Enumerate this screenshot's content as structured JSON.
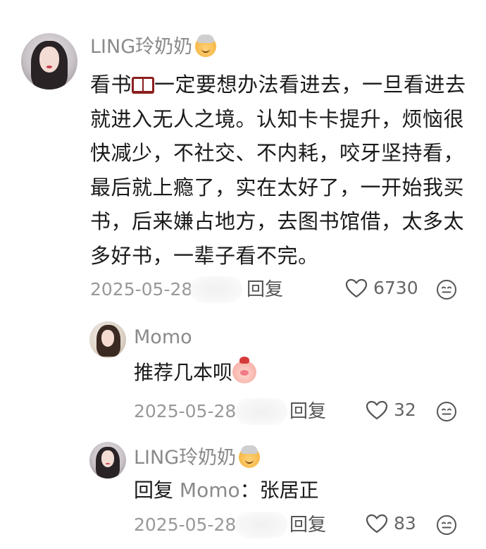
{
  "comments": [
    {
      "author": "LING玲奶奶",
      "author_emoji": "older-woman-emoji",
      "text_before_icon": "看书",
      "inline_icon": "book-emoji",
      "text_after_icon": "一定要想办法看进去，一旦看进去就进入无人之境。认知卡卡提升，烦恼很快减少，不社交、不内耗，咬牙坚持看，最后就上瘾了，实在太好了，一开始我买书，后来嫌占地方，去图书馆借，太多太多好书，一辈子看不完。",
      "date": "2025-05-28",
      "reply_label": "回复",
      "likes": "6730",
      "like_icon": "heart-outline-icon",
      "reaction_icon": "smiley-face-icon"
    }
  ],
  "replies": [
    {
      "author": "Momo",
      "text": "推荐几本呗",
      "trailing_emoji": "pig-emoji",
      "date": "2025-05-28",
      "reply_label": "回复",
      "likes": "32",
      "like_icon": "heart-outline-icon",
      "reaction_icon": "smiley-face-icon"
    },
    {
      "author": "LING玲奶奶",
      "author_emoji": "older-woman-emoji",
      "reply_prefix": "回复",
      "reply_to": "Momo",
      "separator": "：",
      "text": "张居正",
      "date": "2025-05-28",
      "reply_label": "回复",
      "likes": "83",
      "like_icon": "heart-outline-icon",
      "reaction_icon": "smiley-face-icon"
    }
  ],
  "colors": {
    "text_primary": "#1a1a1a",
    "text_secondary": "#8a8a8a",
    "meta": "#999999"
  }
}
